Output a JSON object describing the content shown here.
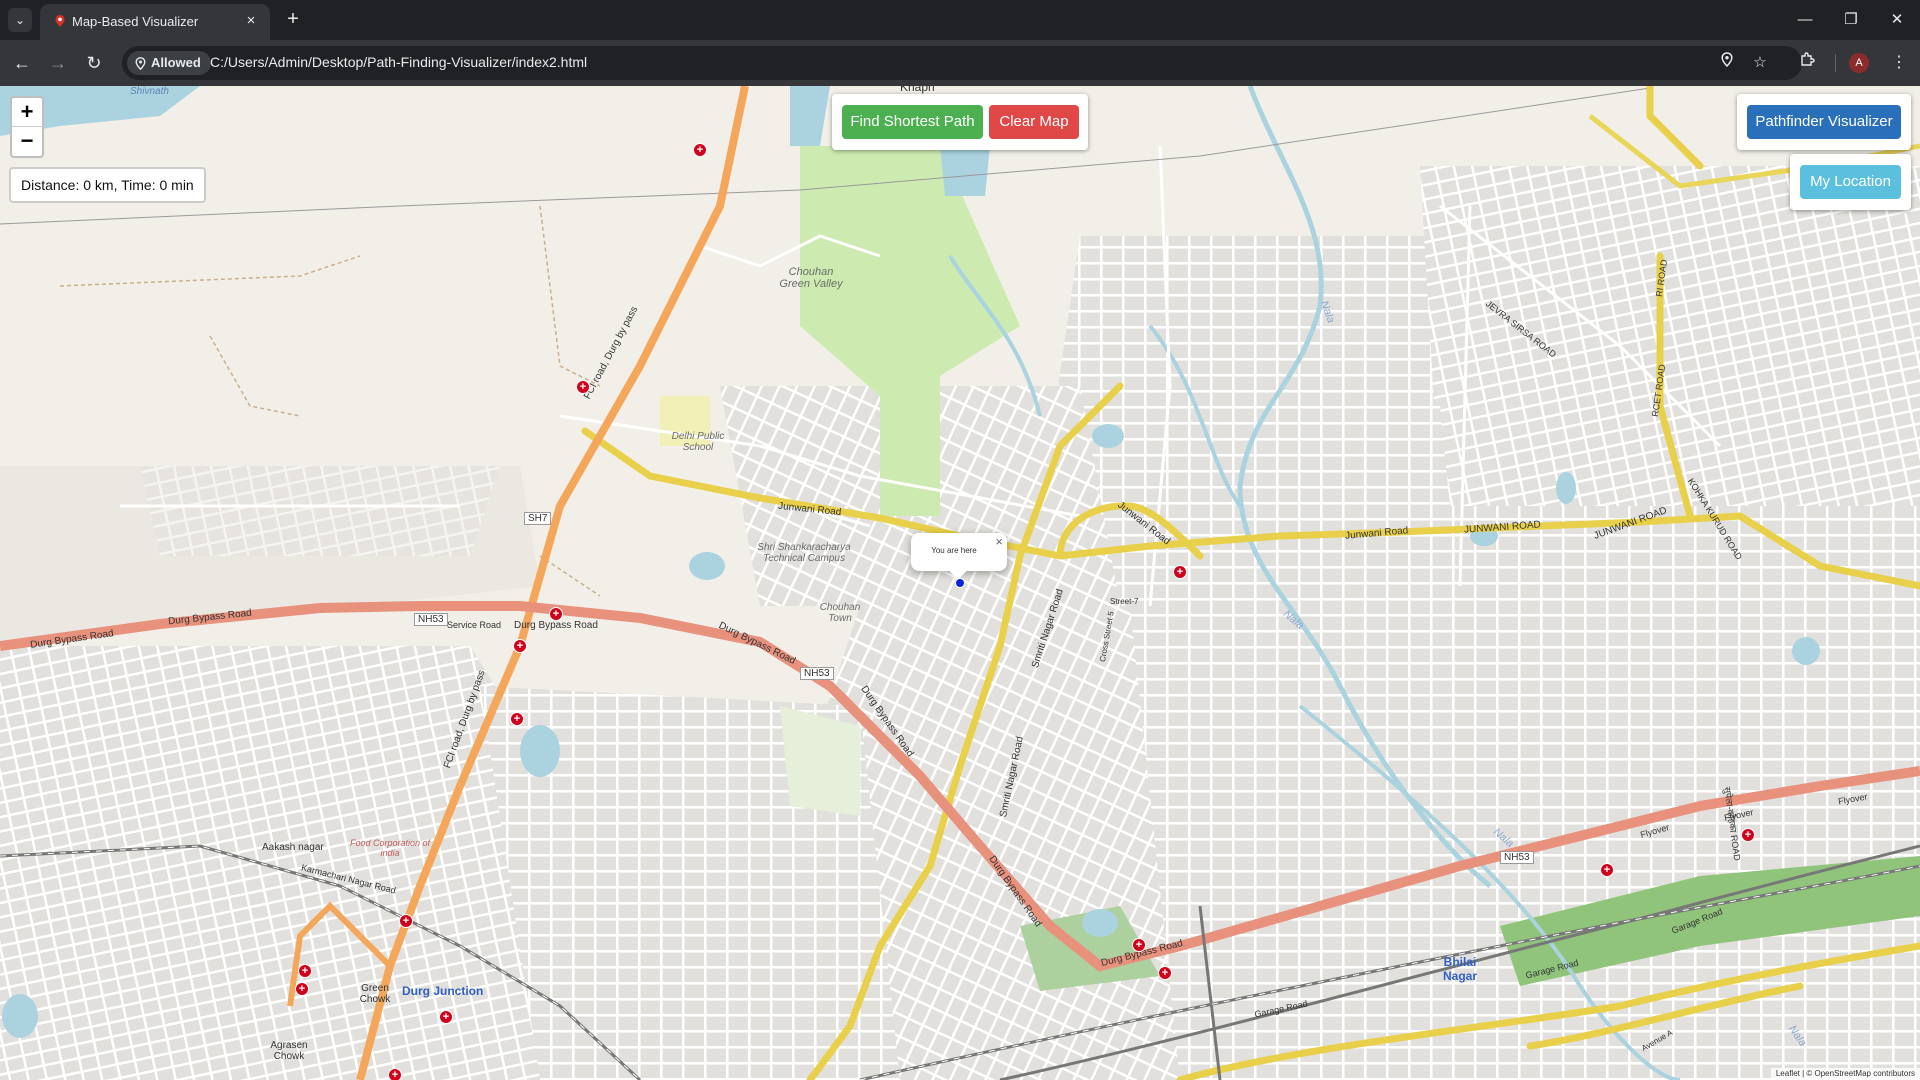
{
  "browser": {
    "tab_title": "Map-Based Visualizer",
    "site_permission": "Allowed",
    "url": "C:/Users/Admin/Desktop/Path-Finding-Visualizer/index2.html",
    "profile_initial": "A"
  },
  "map": {
    "zoom_in": "+",
    "zoom_out": "−",
    "info": "Distance: 0 km, Time: 0 min",
    "controls": {
      "find_label": "Find Shortest Path",
      "clear_label": "Clear Map"
    },
    "brand_label": "Pathfinder Visualizer",
    "my_location_label": "My Location",
    "popup": {
      "text": "You are here",
      "close": "×"
    },
    "attribution": "Leaflet | © OpenStreetMap contributors",
    "labels": {
      "shivnath": "Shivnath",
      "khapri": "Khapri",
      "chouhan_green_valley": "Chouhan Green Valley",
      "delhi_public_school": "Delhi Public School",
      "shri_shankaracharya": "Shri Shankaracharya Technical Campus",
      "chouhan_town": "Chouhan Town",
      "junwani_road_1": "Junwani Road",
      "junwani_road_2": "Junwani Road",
      "junwani_road_3": "Junwani Road",
      "junwani_road_4": "JUNWANI ROAD",
      "durg_bypass_1": "Durg Bypass Road",
      "durg_bypass_2": "Durg Bypass Road",
      "durg_bypass_3": "Durg Bypass Road",
      "durg_bypass_4": "Durg Bypass Road",
      "durg_bypass_5": "Durg Bypass Road",
      "durg_bypass_6": "Durg Bypass Road",
      "service_road": "Service Road",
      "fci_road_1": "FCI road, Durg by pass",
      "fci_road_2": "FCI road, Durg by pass",
      "smriti_nagar_1": "Smriti Nagar Road",
      "smriti_nagar_2": "Smriti Nagar Road",
      "street_7": "Street-7",
      "cross_street_5": "Cross Street 5",
      "jevra_sirsa": "JEVRA SIRSA ROAD",
      "ri_road": "RI ROAD",
      "rcet_road": "RCET ROAD",
      "kohka_kurud": "KOHKA KURUD ROAD",
      "supela_kohka": "सुपेला-कोहका ROAD",
      "flyover_1": "Flyover",
      "flyover_2": "Flyover",
      "flyover_3": "Flyover",
      "garage_road_1": "Garage Road",
      "garage_road_2": "Garage Road",
      "garage_road_3": "Garage Road",
      "aakash_nagar": "Aakash nagar",
      "karmachari": "Karmachari Nagar Road",
      "food_corp": "Food Corporation of india",
      "green_chowk": "Green Chowk",
      "durg_junction": "Durg Junction",
      "agrasen_chowk": "Agrasen Chowk",
      "bhilai_nagar": "Bhilai Nagar",
      "avenue_a": "Avenue A",
      "nala_1": "Nala",
      "nala_2": "Nala",
      "nala_3": "Nala",
      "nala_4": "Nala",
      "sh7": "SH7",
      "nh53_1": "NH53",
      "nh53_2": "NH53",
      "nh53_3": "NH53"
    }
  }
}
